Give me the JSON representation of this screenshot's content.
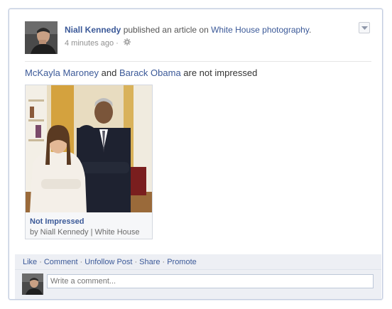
{
  "post": {
    "author": "Niall Kennedy",
    "action_text": " published an article on ",
    "target": "White House photography",
    "target_suffix": ".",
    "timestamp": "4 minutes ago",
    "meta_separator": " ·",
    "message": {
      "person1": "McKayla Maroney",
      "and_text": " and ",
      "person2": "Barack Obama",
      "rest": " are not impressed"
    }
  },
  "attachment": {
    "title": "Not Impressed",
    "source": "by Niall Kennedy | White House"
  },
  "actions": {
    "like": "Like",
    "comment": "Comment",
    "unfollow": "Unfollow Post",
    "share": "Share",
    "promote": "Promote",
    "separator": "·"
  },
  "comment_box": {
    "placeholder": "Write a comment..."
  },
  "icons": {
    "privacy": "gear-icon",
    "menu": "chevron-down-icon"
  },
  "colors": {
    "link": "#3b5998",
    "footer_bg": "#edeff4"
  }
}
